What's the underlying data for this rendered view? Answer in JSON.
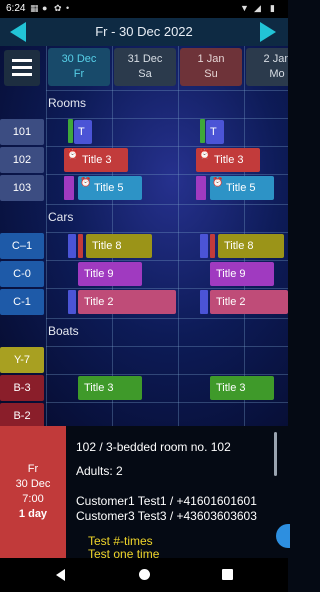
{
  "status": {
    "time": "6:24"
  },
  "header": {
    "title": "Fr - 30 Dec 2022"
  },
  "days": [
    {
      "line1": "30 Dec",
      "line2": "Fr",
      "bg": "#184a6a",
      "fg": "#57d0e8"
    },
    {
      "line1": "31 Dec",
      "line2": "Sa",
      "bg": "#2b3a4c",
      "fg": "#d7dde4"
    },
    {
      "line1": "1 Jan",
      "line2": "Su",
      "bg": "#6e3339",
      "fg": "#e4d4d4"
    },
    {
      "line1": "2 Jan",
      "line2": "Mo",
      "bg": "#2b3a4c",
      "fg": "#d7dde4"
    }
  ],
  "sections": {
    "rooms": "Rooms",
    "cars": "Cars",
    "boats": "Boats"
  },
  "rows": {
    "r101": "101",
    "r102": "102",
    "r103": "103",
    "c1m": "C–1",
    "c0": "C-0",
    "c1": "C-1",
    "y7": "Y-7",
    "b3": "B-3",
    "b2": "B-2"
  },
  "bars": {
    "t": "T",
    "title3": "Title 3",
    "title5": "Title 5",
    "title8": "Title 8",
    "title9": "Title 9",
    "title2": "Title 2"
  },
  "detail": {
    "day": "Fr",
    "date": "30 Dec",
    "time": "7:00",
    "duration": "1 day",
    "heading": "102  /  3-bedded room no. 102",
    "adults": "Adults: 2",
    "customer1": "Customer1 Test1 / +41601601601",
    "customer2": "Customer3 Test3 / +43603603603",
    "note1": "Test #-times",
    "note2": "Test one time"
  },
  "colors": {
    "accent": "#22c3d6",
    "blue_bar": "#4b54d6",
    "red_bar": "#c23b3b",
    "cyan_bar": "#2d93c6",
    "olive_bar": "#9b9418",
    "purple_bar": "#a03ac0",
    "pink_bar": "#bf4c78",
    "green_bar": "#3f9a2a"
  }
}
